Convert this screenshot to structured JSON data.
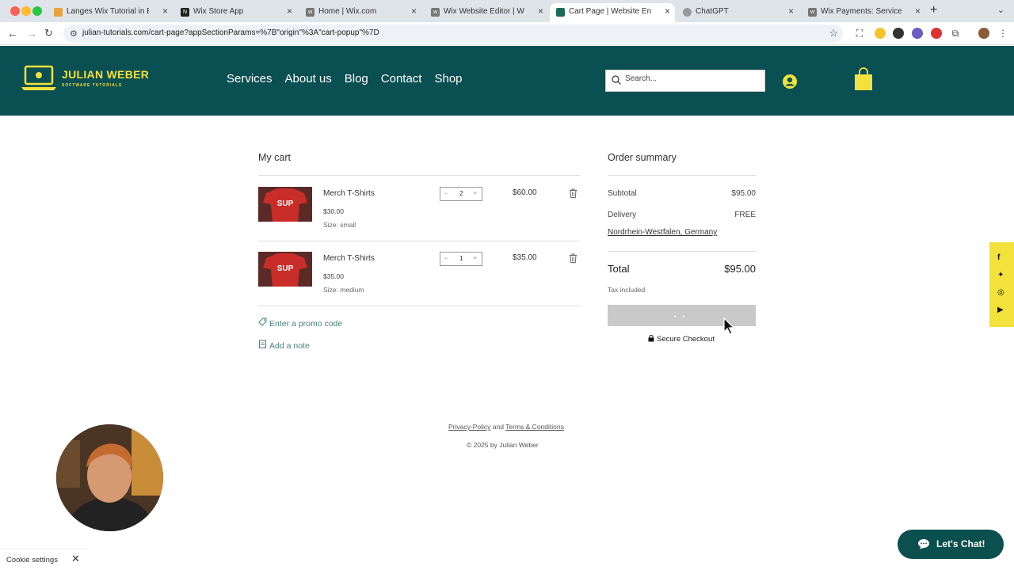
{
  "browser": {
    "tabs": [
      {
        "label": "Langes Wix Tutorial in English",
        "icon": "medal-icon"
      },
      {
        "label": "Wix Store App",
        "icon": "notion-icon"
      },
      {
        "label": "Home | Wix.com",
        "icon": "wix-icon"
      },
      {
        "label": "Wix Website Editor | Website",
        "icon": "wix-icon"
      },
      {
        "label": "Cart Page | Website English",
        "icon": "site-icon",
        "active": true
      },
      {
        "label": "ChatGPT",
        "icon": "chatgpt-icon"
      },
      {
        "label": "Wix Payments: Service Fees",
        "icon": "wix-icon"
      }
    ],
    "url": "julian-tutorials.com/cart-page?appSectionParams=%7B\"origin\"%3A\"cart-popup\"%7D"
  },
  "header": {
    "brand": "JULIAN WEBER",
    "tagline": "SOFTWARE TUTORIALS",
    "nav": [
      "Services",
      "About us",
      "Blog",
      "Contact",
      "Shop"
    ],
    "search_placeholder": "Search...",
    "brand_color": "#0a4f51",
    "accent_color": "#f3e13c"
  },
  "cart": {
    "title": "My cart",
    "items": [
      {
        "name": "Merch T-Shirts",
        "unit_price": "$30.00",
        "size": "Size: small",
        "quantity": "2",
        "total": "$60.00"
      },
      {
        "name": "Merch T-Shirts",
        "unit_price": "$35.00",
        "size": "Size: medium",
        "quantity": "1",
        "total": "$35.00"
      }
    ],
    "promo_label": "Enter a promo code",
    "note_label": "Add a note"
  },
  "summary": {
    "title": "Order summary",
    "subtotal_label": "Subtotal",
    "subtotal_value": "$95.00",
    "delivery_label": "Delivery",
    "delivery_value": "FREE",
    "region": "Nordrhein-Westfalen, Germany",
    "total_label": "Total",
    "total_value": "$95.00",
    "tax_note": "Tax included",
    "secure_label": "Secure Checkout"
  },
  "footer": {
    "privacy": "Privacy-Policy",
    "and": "and",
    "terms": "Terms & Conditions",
    "copyright": "© 2025 by Julian Weber"
  },
  "cookie": {
    "label": "Cookie settings"
  },
  "chat": {
    "label": "Let's Chat!"
  }
}
